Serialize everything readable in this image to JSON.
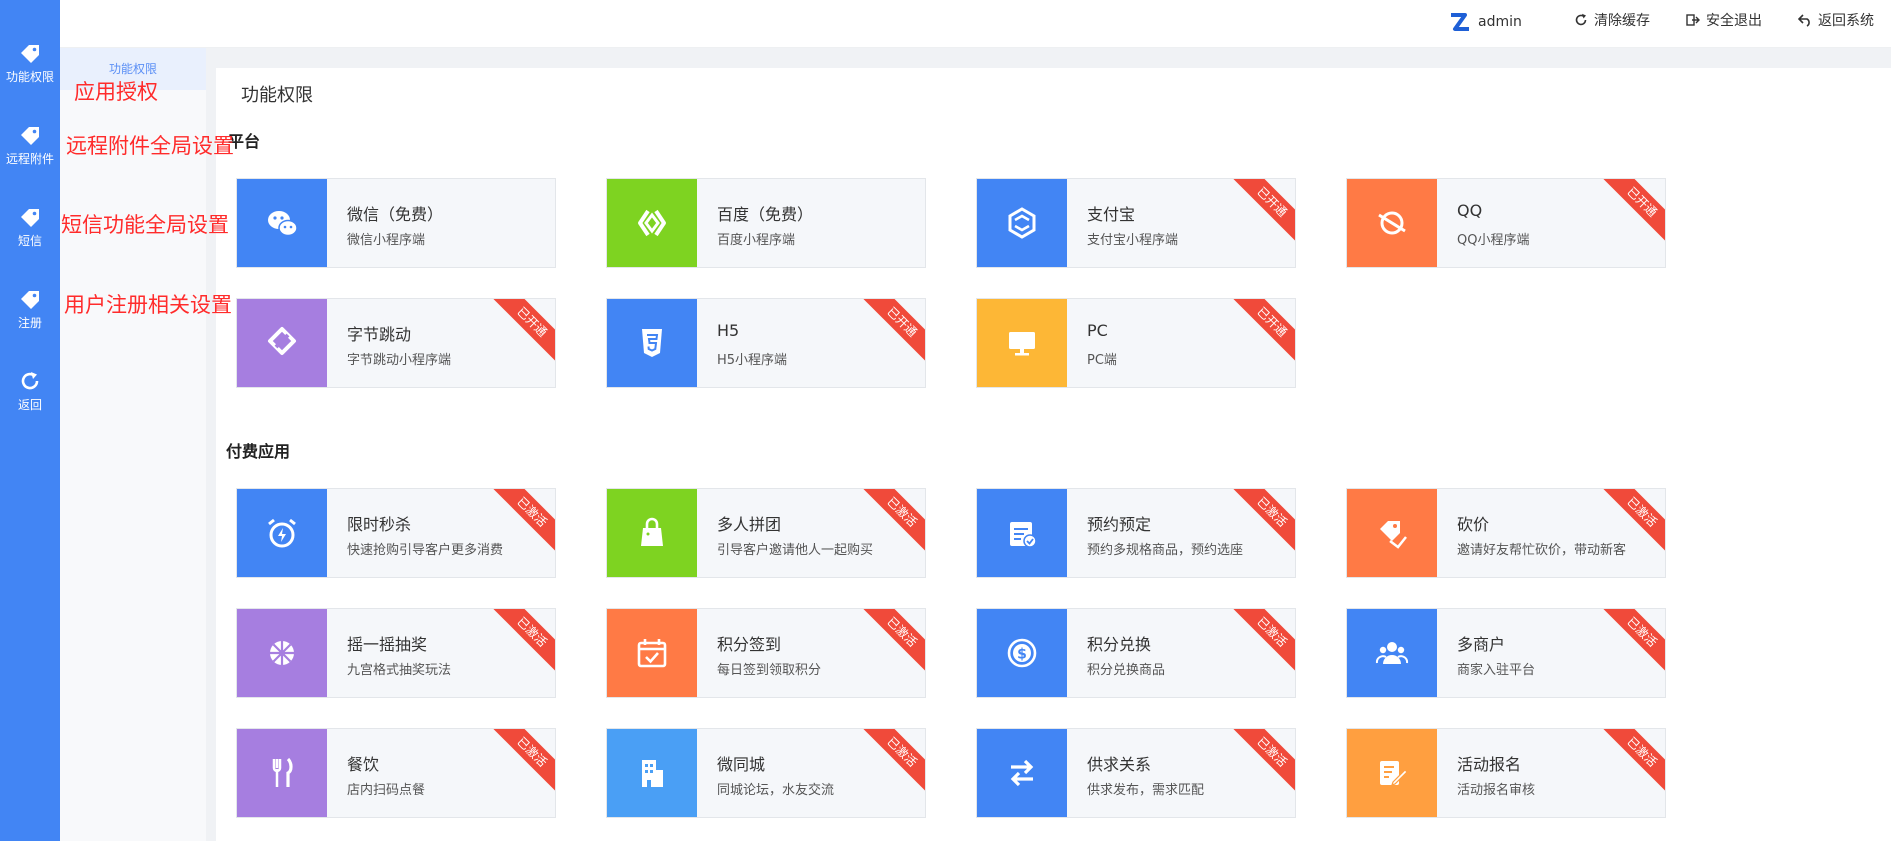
{
  "sidebar": {
    "items": [
      {
        "label": "功能权限",
        "icon": "tag-icon"
      },
      {
        "label": "远程附件",
        "icon": "tag-icon"
      },
      {
        "label": "短信",
        "icon": "tag-icon"
      },
      {
        "label": "注册",
        "icon": "tag-icon"
      },
      {
        "label": "返回",
        "icon": "refresh-icon"
      }
    ]
  },
  "subnav": {
    "active_label": "功能权限"
  },
  "annotations": [
    "应用授权",
    "远程附件全局设置",
    "短信功能全局设置",
    "用户注册相关设置"
  ],
  "topbar": {
    "user": "admin",
    "clear_cache": "清除缓存",
    "logout": "安全退出",
    "back_system": "返回系统"
  },
  "page_title": "功能权限",
  "sections": {
    "platform": "平台",
    "paid": "付费应用"
  },
  "platform_cards": [
    {
      "name": "微信（免费）",
      "desc": "微信小程序端",
      "color": "#4285f4",
      "icon": "wechat-icon",
      "ribbon": ""
    },
    {
      "name": "百度（免费）",
      "desc": "百度小程序端",
      "color": "#7ed321",
      "icon": "baidu-icon",
      "ribbon": ""
    },
    {
      "name": "支付宝",
      "desc": "支付宝小程序端",
      "color": "#4285f4",
      "icon": "alipay-icon",
      "ribbon": "已开通"
    },
    {
      "name": "QQ",
      "desc": "QQ小程序端",
      "color": "#ff7a45",
      "icon": "qq-icon",
      "ribbon": "已开通"
    },
    {
      "name": "字节跳动",
      "desc": "字节跳动小程序端",
      "color": "#a67ee0",
      "icon": "bytedance-icon",
      "ribbon": "已开通"
    },
    {
      "name": "H5",
      "desc": "H5小程序端",
      "color": "#4285f4",
      "icon": "html5-icon",
      "ribbon": "已开通"
    },
    {
      "name": "PC",
      "desc": "PC端",
      "color": "#fdb736",
      "icon": "monitor-icon",
      "ribbon": "已开通"
    }
  ],
  "paid_cards": [
    {
      "name": "限时秒杀",
      "desc": "快速抢购引导客户更多消费",
      "color": "#4285f4",
      "icon": "alarm-clock-icon",
      "ribbon": "已激活"
    },
    {
      "name": "多人拼团",
      "desc": "引导客户邀请他人一起购买",
      "color": "#7ed321",
      "icon": "shopping-bag-icon",
      "ribbon": "已激活"
    },
    {
      "name": "预约预定",
      "desc": "预约多规格商品，预约选座",
      "color": "#4285f4",
      "icon": "calendar-check-icon",
      "ribbon": "已激活"
    },
    {
      "name": "砍价",
      "desc": "邀请好友帮忙砍价，带动新客",
      "color": "#ff7a45",
      "icon": "price-tag-icon",
      "ribbon": "已激活"
    },
    {
      "name": "摇一摇抽奖",
      "desc": "九宫格式抽奖玩法",
      "color": "#a67ee0",
      "icon": "wheel-icon",
      "ribbon": "已激活"
    },
    {
      "name": "积分签到",
      "desc": "每日签到领取积分",
      "color": "#ff7a45",
      "icon": "calendar-icon",
      "ribbon": "已激活"
    },
    {
      "name": "积分兑换",
      "desc": "积分兑换商品",
      "color": "#4285f4",
      "icon": "coin-icon",
      "ribbon": "已激活"
    },
    {
      "name": "多商户",
      "desc": "商家入驻平台",
      "color": "#4285f4",
      "icon": "users-icon",
      "ribbon": "已激活"
    },
    {
      "name": "餐饮",
      "desc": "店内扫码点餐",
      "color": "#a67ee0",
      "icon": "cutlery-icon",
      "ribbon": "已激活"
    },
    {
      "name": "微同城",
      "desc": "同城论坛，水友交流",
      "color": "#4a9ff5",
      "icon": "building-icon",
      "ribbon": "已激活"
    },
    {
      "name": "供求关系",
      "desc": "供求发布，需求匹配",
      "color": "#4285f4",
      "icon": "exchange-icon",
      "ribbon": "已激活"
    },
    {
      "name": "活动报名",
      "desc": "活动报名审核",
      "color": "#ff9f40",
      "icon": "edit-form-icon",
      "ribbon": "已激活"
    }
  ]
}
